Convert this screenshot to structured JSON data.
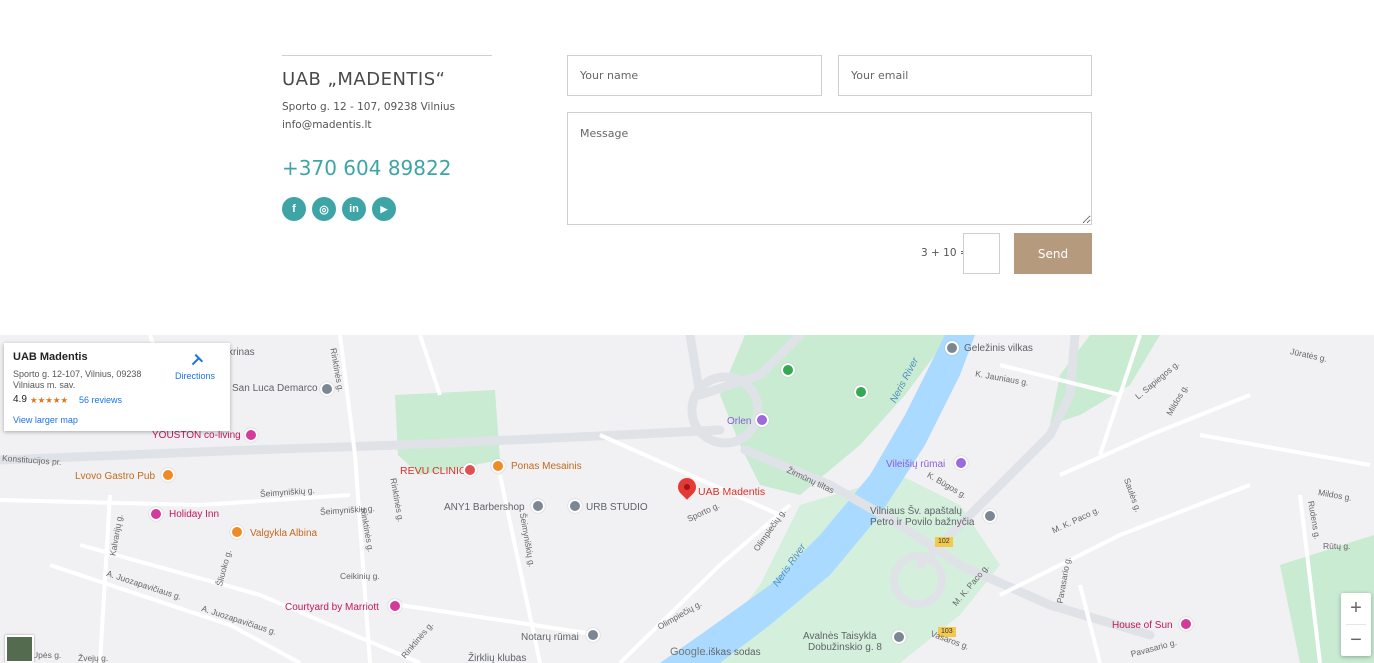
{
  "company": {
    "name": "UAB „MADENTIS“",
    "address": "Sporto g. 12 - 107, 09238 Vilnius",
    "email": "info@madentis.lt",
    "phone": "+370 604 89822",
    "socials": [
      {
        "name": "facebook",
        "glyph": "f"
      },
      {
        "name": "instagram",
        "glyph": "◎"
      },
      {
        "name": "linkedin",
        "glyph": "in"
      },
      {
        "name": "youtube",
        "glyph": "▶"
      }
    ]
  },
  "form": {
    "name_placeholder": "Your name",
    "email_placeholder": "Your email",
    "message_placeholder": "Message",
    "captcha_label": "3 + 10 =",
    "send_label": "Send"
  },
  "map": {
    "card": {
      "title": "UAB Madentis",
      "address": "Sporto g. 12-107, Vilnius, 09238 Vilniaus m. sav.",
      "rating": "4.9",
      "stars": "★★★★★",
      "reviews": "56 reviews",
      "larger_map": "View larger map",
      "directions": "Directions"
    },
    "marker": "UAB Madentis",
    "places": {
      "youston": "YOUSTON co-living",
      "lvovo": "Lvovo Gastro Pub",
      "holiday": "Holiday Inn",
      "valgykla": "Valgykla Albina",
      "revu": "REVU CLINIC",
      "ponas": "Ponas Mesainis",
      "any1": "ANY1 Barbershop",
      "urb": "URB STUDIO",
      "orlen": "Orlen",
      "gelezinis": "Geležinis vilkas",
      "vileisiu": "Vileišių rūmai",
      "baznycia_1": "Vilniaus Šv. apaštalų",
      "baznycia_2": "Petro ir Povilo bažnyčia",
      "courtyard": "Courtyard by Marriott",
      "notaru": "Notarų rūmai",
      "avalnes_1": "Avalnės Taisykla",
      "avalnes_2": "Dobužinskio g. 8",
      "house": "House of Sun",
      "zirkliu": "Žirklių klubas",
      "sodas": "...iškas sodas",
      "san_luca": "San Luca Demarco",
      "krinas": "krinas"
    },
    "roads": {
      "konstitucijos": "Konstitucijos pr.",
      "seimyniskiu1": "Šeimyniškių g.",
      "seimyniskiu2": "Šeimyniškių g.",
      "rinktines1": "Rinktinės g.",
      "rinktines2": "Rinktinės g.",
      "kalvariju": "Kalvarijų g.",
      "juozapaviciaus1": "A. Juozapavičiaus g.",
      "juozapaviciaus2": "A. Juozapavičiaus g.",
      "zirmunu": "Žirmūnų tiltas",
      "olimpieciu1": "Olimpiečių g.",
      "olimpieciu2": "Olimpiečių g.",
      "sporto": "Sporto g.",
      "jauniaus": "K. Jauniaus g.",
      "sapiegos": "L. Sapiegos g.",
      "mildos1": "Mildos g.",
      "mildos2": "Mildos g.",
      "jurates": "Jūratės g.",
      "sauletekio": "Saulės g.",
      "paco1": "M. K. Paco g.",
      "paco2": "M. K. Paco g.",
      "rudens": "Rudens g.",
      "rutu": "Rūtų g.",
      "bugos": "K. Būgos g.",
      "pavasario1": "Pavasario g.",
      "pavasario2": "Pavasario g.",
      "vasaros": "Vasaros g.",
      "ceikiniu": "Ceikinių g.",
      "sliuoko": "Šliuoko g.",
      "upes": "Upės g.",
      "zvejiu": "Žvejų g.",
      "rinktines3": "Rinktinės g.",
      "seimyniskiu3": "Šeimyniškių g.",
      "rinktines4": "Rinktinės g."
    },
    "rivers": {
      "neris1": "Neris River",
      "neris2": "Neris River"
    },
    "road_numbers": {
      "a": "102",
      "b": "103"
    },
    "zoom_in": "+",
    "zoom_out": "−",
    "google_logo": "Google",
    "colors": {
      "water": "#aadaff",
      "park": "#c8ebd2",
      "road": "#ffffff"
    }
  }
}
